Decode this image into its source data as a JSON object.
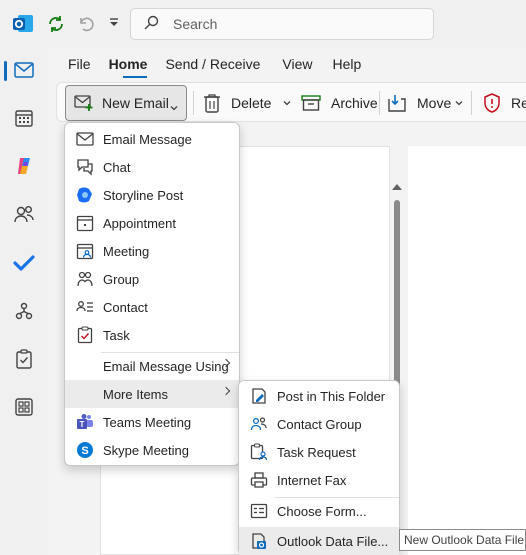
{
  "titlebar": {
    "search_placeholder": "Search"
  },
  "ribbon_tabs": [
    "File",
    "Home",
    "Send / Receive",
    "View",
    "Help"
  ],
  "ribbon": {
    "new_email": "New Email",
    "delete": "Delete",
    "archive": "Archive",
    "move": "Move",
    "report": "Re"
  },
  "new_menu": {
    "items": [
      {
        "label": "Email Message",
        "icon": "envelope-icon"
      },
      {
        "label": "Chat",
        "icon": "chat-icon"
      },
      {
        "label": "Storyline Post",
        "icon": "storyline-icon"
      },
      {
        "label": "Appointment",
        "icon": "calendar-icon"
      },
      {
        "label": "Meeting",
        "icon": "meeting-icon"
      },
      {
        "label": "Group",
        "icon": "group-icon"
      },
      {
        "label": "Contact",
        "icon": "contact-icon"
      },
      {
        "label": "Task",
        "icon": "task-icon"
      },
      {
        "label": "Email Message Using",
        "icon": ""
      },
      {
        "label": "More Items",
        "icon": ""
      },
      {
        "label": "Teams Meeting",
        "icon": "teams-icon"
      },
      {
        "label": "Skype Meeting",
        "icon": "skype-icon"
      }
    ]
  },
  "more_items_menu": {
    "items": [
      {
        "label": "Post in This Folder",
        "icon": "post-icon"
      },
      {
        "label": "Contact Group",
        "icon": "contact-group-icon"
      },
      {
        "label": "Task Request",
        "icon": "task-request-icon"
      },
      {
        "label": "Internet Fax",
        "icon": "fax-icon"
      },
      {
        "label": "Choose Form...",
        "icon": "form-icon"
      },
      {
        "label": "Outlook Data File...",
        "icon": "data-file-icon"
      }
    ]
  },
  "tooltip": "New Outlook Data File",
  "colors": {
    "accent": "#0f6cbd",
    "warning_red": "#c50f1f"
  }
}
